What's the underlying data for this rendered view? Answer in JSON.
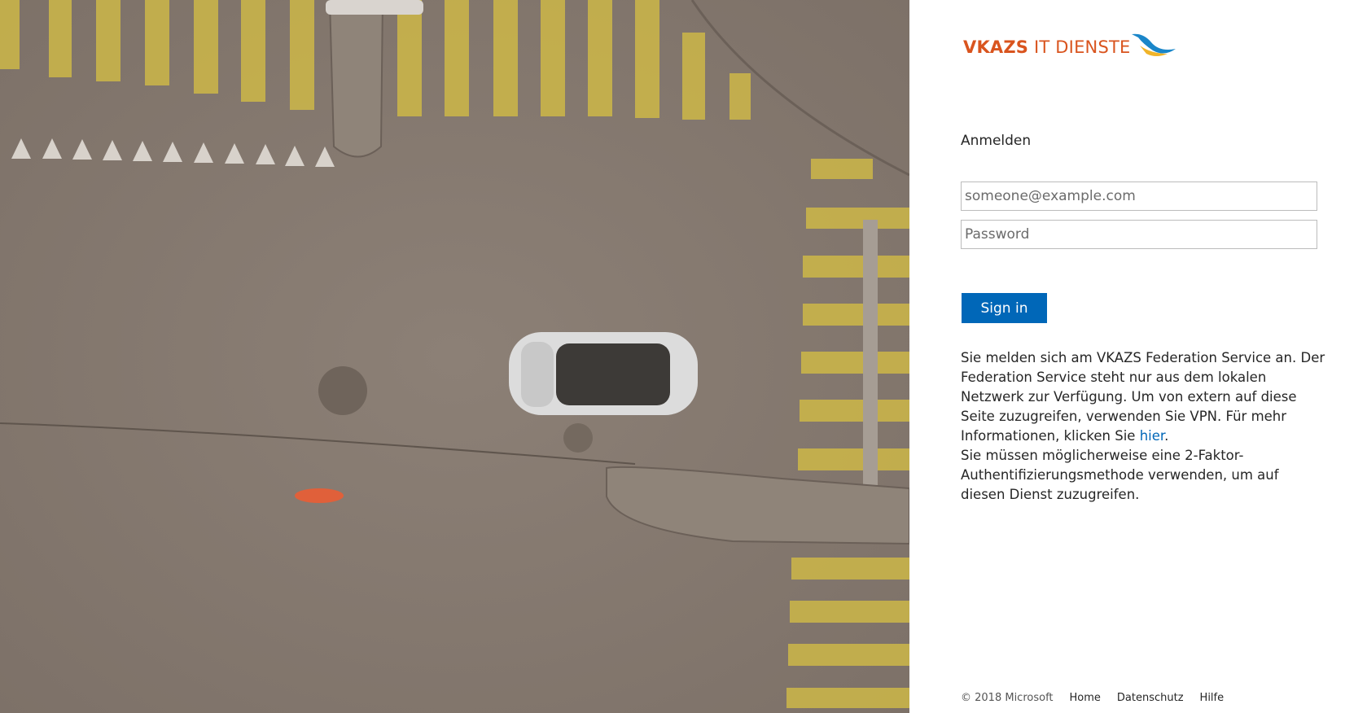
{
  "brand": {
    "name_bold": "VKAZS",
    "name_rest": " IT DIENSTE",
    "color": "#d9541e",
    "accent_color": "#1a86c9"
  },
  "signin": {
    "heading": "Anmelden",
    "email_placeholder": "someone@example.com",
    "password_placeholder": "Password",
    "button_label": "Sign in",
    "button_color": "#0067b8"
  },
  "info": {
    "text1": "Sie melden sich am VKAZS Federation Service an. Der Federation Service steht nur aus dem lokalen Netzwerk zur Verfügung. Um von extern auf diese Seite zuzugreifen, verwenden Sie VPN. Für mehr Informationen, klicken Sie ",
    "link": "hier",
    "text1_end": ".",
    "text2": "Sie müssen möglicherweise eine 2-Faktor-Authentifizierungsmethode verwenden, um auf diesen Dienst zuzugreifen."
  },
  "footer": {
    "copyright": "© 2018 Microsoft",
    "links": [
      "Home",
      "Datenschutz",
      "Hilfe"
    ]
  },
  "illustration": {
    "description_icon": "aerial-street-crossing-image"
  }
}
